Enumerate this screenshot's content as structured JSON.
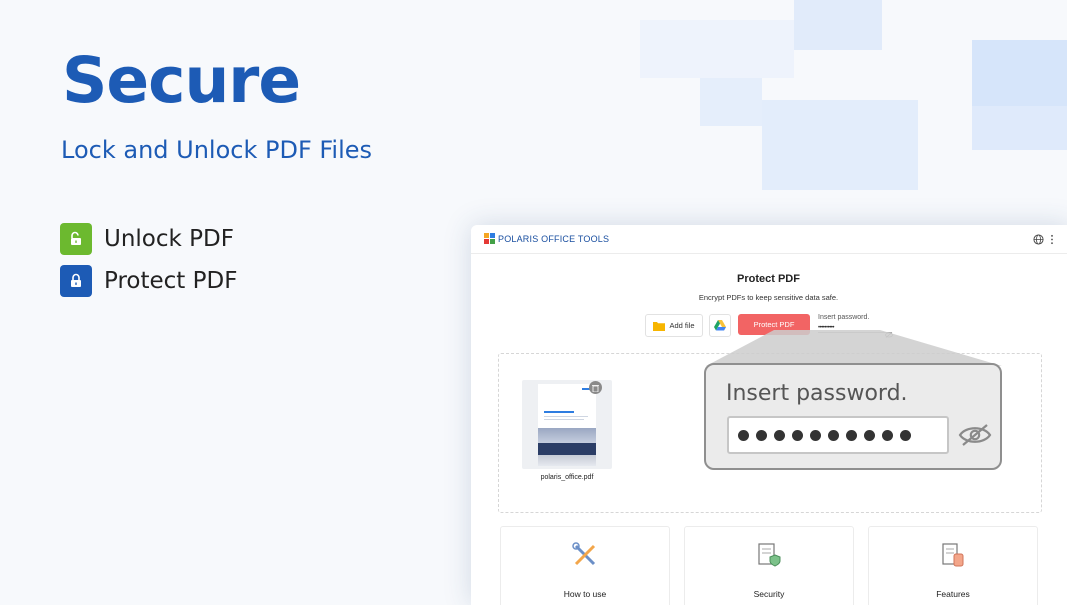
{
  "hero": {
    "title": "Secure",
    "subtitle": "Lock and Unlock PDF Files",
    "features": [
      {
        "label": "Unlock PDF",
        "icon": "unlock-icon",
        "color": "#6cb92f"
      },
      {
        "label": "Protect PDF",
        "icon": "lock-icon",
        "color": "#1d5bb5"
      }
    ]
  },
  "app": {
    "logo_text": "POLARIS OFFICE TOOLS",
    "header_icons": [
      "globe-icon",
      "more-vertical-icon"
    ],
    "page_title": "Protect PDF",
    "page_description": "Encrypt PDFs to keep sensitive data safe.",
    "add_file_label": "Add file",
    "protect_button_label": "Protect PDF",
    "password_label": "Insert password.",
    "password_value": "••••••••••",
    "file": {
      "name": "polaris_office.pdf"
    },
    "cards": [
      {
        "label": "How to use",
        "icon": "tools-icon"
      },
      {
        "label": "Security",
        "icon": "document-shield-icon"
      },
      {
        "label": "Features",
        "icon": "document-touch-icon"
      }
    ]
  },
  "callout": {
    "label": "Insert password.",
    "dot_count": 10
  },
  "colors": {
    "brand_blue": "#1d5bb5",
    "protect_red": "#f26464",
    "unlock_green": "#6cb92f"
  }
}
